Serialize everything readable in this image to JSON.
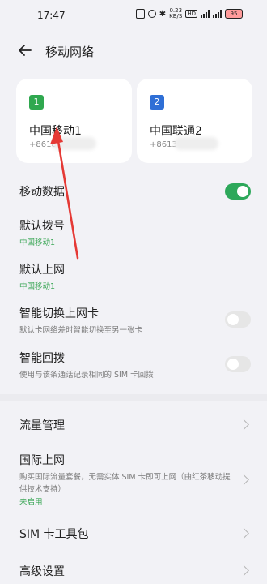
{
  "status": {
    "time": "17:47",
    "net_speed": "0.23\nKB/S",
    "battery": "95"
  },
  "header": {
    "title": "移动网络"
  },
  "sims": [
    {
      "slot": "1",
      "name": "中国移动1",
      "number": "+8618",
      "color": "#2fa84f"
    },
    {
      "slot": "2",
      "name": "中国联通2",
      "number": "+8613",
      "color": "#2f6fd6"
    }
  ],
  "rows": {
    "mobile_data": {
      "title": "移动数据",
      "enabled": true
    },
    "default_call": {
      "title": "默认拨号",
      "sub": "中国移动1"
    },
    "default_internet": {
      "title": "默认上网",
      "sub": "中国移动1"
    },
    "smart_switch": {
      "title": "智能切换上网卡",
      "sub": "默认卡网络差时智能切换至另一张卡",
      "enabled": false
    },
    "smart_callback": {
      "title": "智能回拨",
      "sub": "使用与该条通话记录相同的 SIM 卡回拨",
      "enabled": false
    },
    "traffic": {
      "title": "流量管理"
    },
    "intl": {
      "title": "国际上网",
      "sub": "购买国际流量套餐，无需实体 SIM 卡即可上网（由红茶移动提供技术支持）",
      "status": "未启用"
    },
    "sim_toolkit": {
      "title": "SIM 卡工具包"
    },
    "advanced": {
      "title": "高级设置"
    }
  },
  "colors": {
    "accent": "#2da85a",
    "annotation_arrow": "#e53935"
  }
}
